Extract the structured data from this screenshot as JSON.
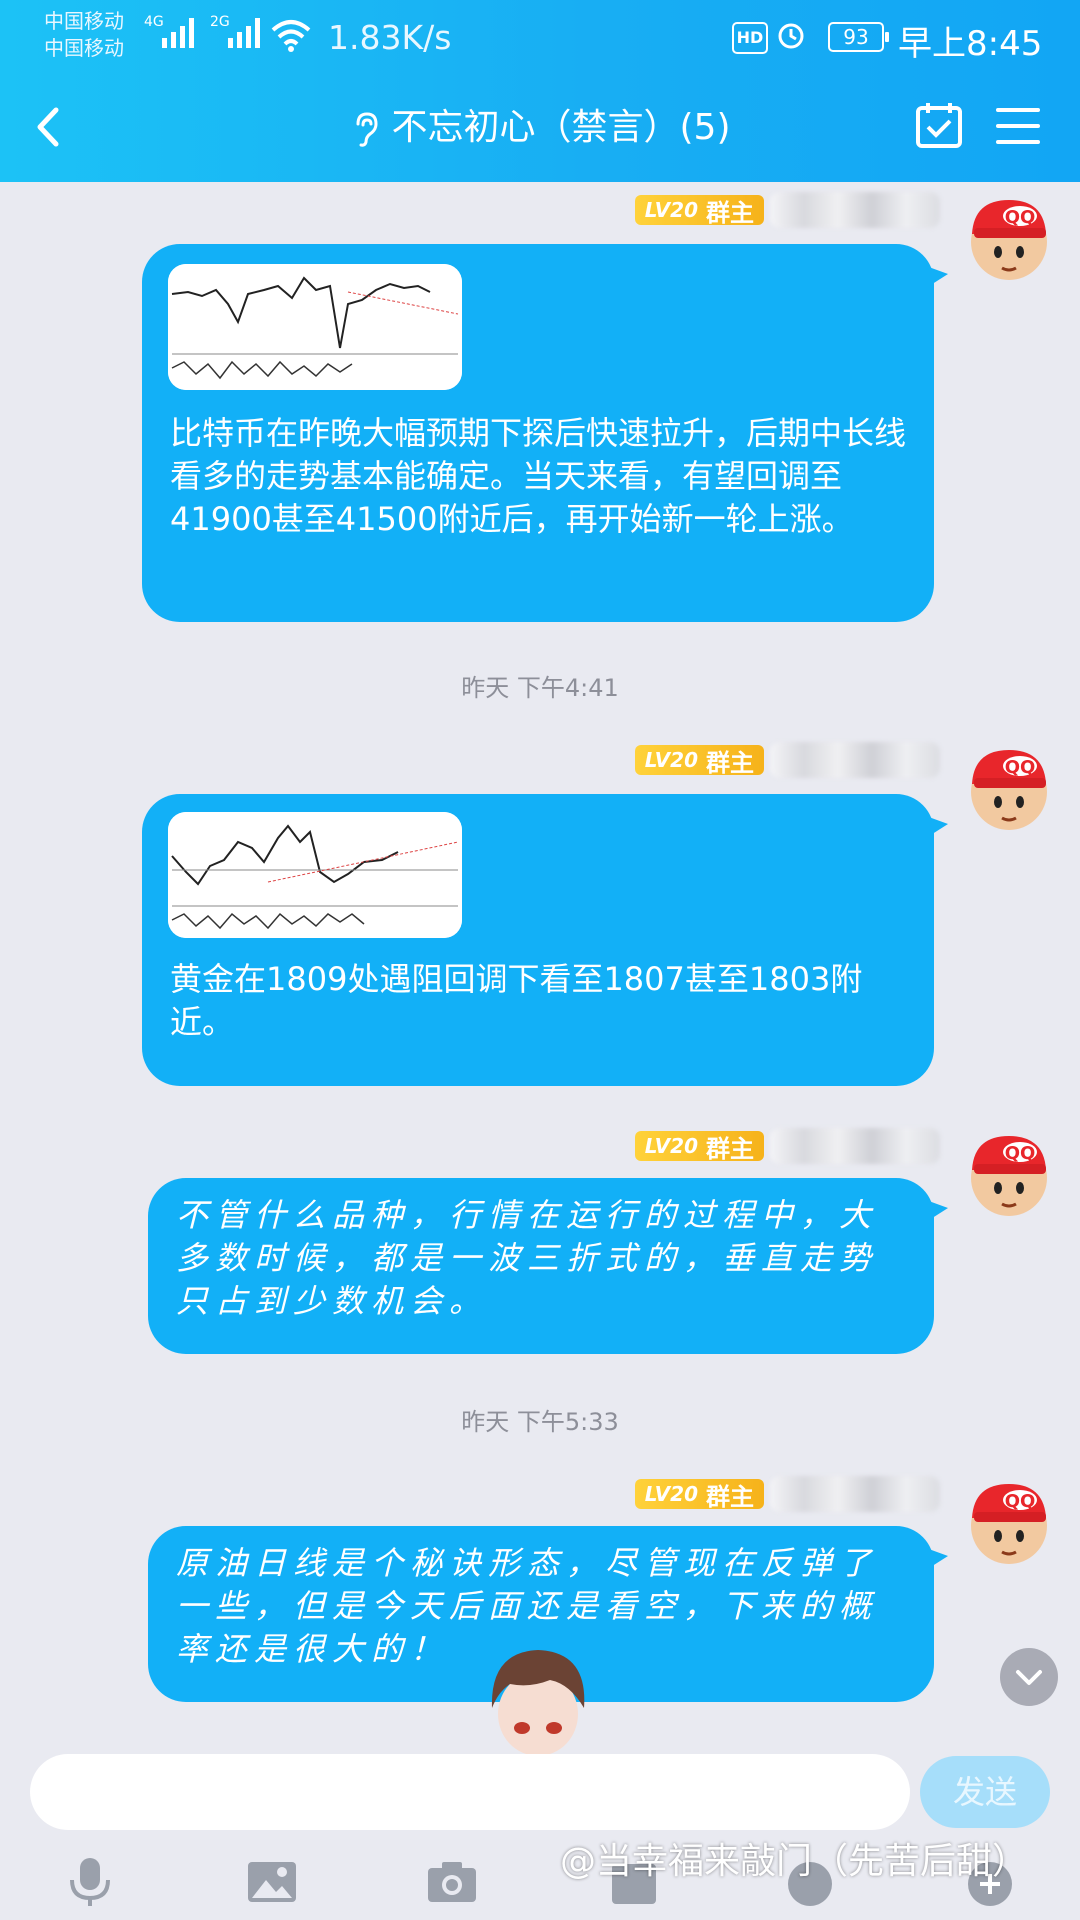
{
  "status_bar": {
    "carrier1": "中国移动",
    "carrier2": "中国移动",
    "sim1_type": "4G",
    "sim2_type": "2G",
    "speed": "1.83K/s",
    "hd": "HD",
    "battery": "93",
    "time": "早上8:45"
  },
  "header": {
    "title": "不忘初心（禁言）(5)",
    "back_icon": "chevron-left-icon",
    "ear_icon": "ear-icon",
    "calendar_icon": "calendar-check-icon",
    "menu_icon": "hamburger-menu-icon"
  },
  "messages": [
    {
      "level": "LV20",
      "role": "群主",
      "text": "比特币在昨晚大幅预期下探后快速拉升，后期中长线看多的走势基本能确定。当天来看，有望回调至41900甚至41500附近后，再开始新一轮上涨。",
      "has_image": true
    },
    {
      "timestamp": "昨天 下午4:41"
    },
    {
      "level": "LV20",
      "role": "群主",
      "text": "黄金在1809处遇阻回调下看至1807甚至1803附近。",
      "has_image": true
    },
    {
      "level": "LV20",
      "role": "群主",
      "text": "不管什么品种，行情在运行的过程中，大多数时候，都是一波三折式的，垂直走势只占到少数机会。",
      "has_image": false
    },
    {
      "timestamp": "昨天 下午5:33"
    },
    {
      "level": "LV20",
      "role": "群主",
      "text": "原油日线是个秘诀形态，尽管现在反弹了一些，但是今天后面还是看空，下来的概率还是很大的！",
      "has_image": false
    }
  ],
  "input": {
    "placeholder": "",
    "send_label": "发送"
  },
  "toolbar": [
    "microphone-icon",
    "image-icon",
    "camera-icon",
    "sticker-icon",
    "emoji-icon",
    "plus-icon"
  ],
  "watermark": "@当幸福来敲门（先苦后甜）",
  "colors": {
    "header": "#18aef3",
    "bubble": "#12b0f7",
    "background": "#e9eaf1",
    "level_badge": "#f6b21a"
  }
}
